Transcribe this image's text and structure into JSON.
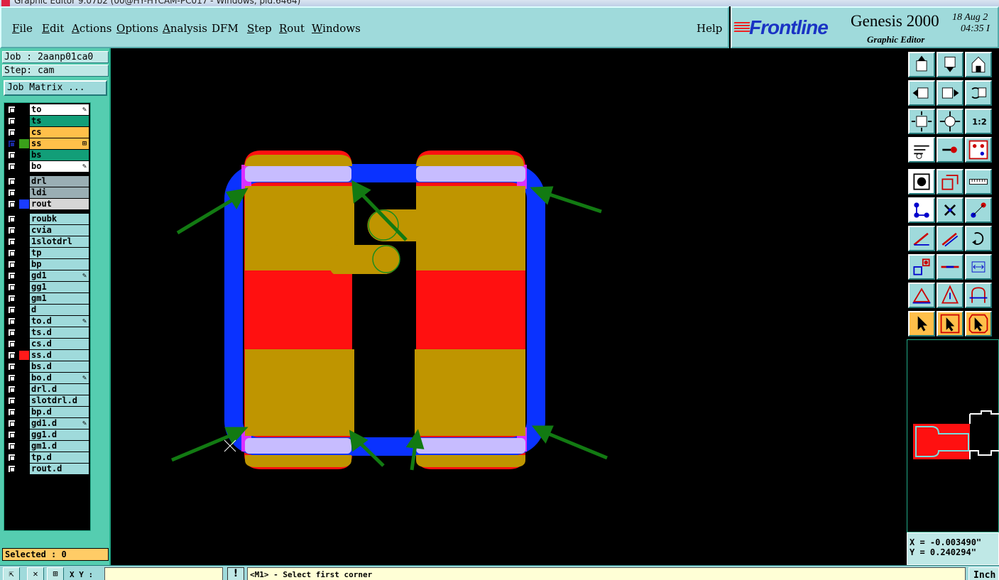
{
  "window": {
    "title": "Graphic Editor 9.07b2 (00@HY-HYCAM-PC017 - Windows, pid:6464)"
  },
  "menu": [
    {
      "label": "File",
      "ul": "F",
      "rest": "ile"
    },
    {
      "label": "Edit",
      "ul": "E",
      "rest": "dit"
    },
    {
      "label": "Actions",
      "ul": "A",
      "rest": "ctions"
    },
    {
      "label": "Options",
      "ul": "O",
      "rest": "ptions"
    },
    {
      "label": "Analysis",
      "ul": "A",
      "rest": "nalysis"
    },
    {
      "label": "DFM",
      "ul": "",
      "rest": "DFM"
    },
    {
      "label": "Step",
      "ul": "S",
      "rest": "tep"
    },
    {
      "label": "Rout",
      "ul": "R",
      "rest": "out"
    },
    {
      "label": "Windows",
      "ul": "W",
      "rest": "indows"
    },
    {
      "label": "Help",
      "ul": "",
      "rest": "Help"
    }
  ],
  "brand": {
    "logo": "Frontline",
    "product": "Genesis 2000",
    "subtitle": "Graphic Editor",
    "date": "18 Aug 2",
    "time": "04:35 I"
  },
  "job": {
    "job_label": "Job : 2aanp01ca0",
    "step_label": "Step: cam",
    "matrix_button": "Job Matrix ..."
  },
  "layers": [
    {
      "name": "to",
      "bg": "#ffffff",
      "swatch": "#000000",
      "mark": "✎"
    },
    {
      "name": "ts",
      "bg": "#129e78",
      "swatch": "#000000",
      "mark": ""
    },
    {
      "name": "cs",
      "bg": "#ffc04a",
      "swatch": "#000000",
      "mark": ""
    },
    {
      "name": "ss",
      "bg": "#ffc04a",
      "swatch": "#3aa01a",
      "mark": "⊞",
      "active": true
    },
    {
      "name": "bs",
      "bg": "#129e78",
      "swatch": "#000000",
      "mark": ""
    },
    {
      "name": "bo",
      "bg": "#ffffff",
      "swatch": "#000000",
      "mark": "✎"
    },
    {
      "name": "drl",
      "bg": "#9aaeb4",
      "swatch": "#000000",
      "mark": "",
      "gap": true
    },
    {
      "name": "ldi",
      "bg": "#9aaeb4",
      "swatch": "#000000",
      "mark": ""
    },
    {
      "name": "rout",
      "bg": "#d6d6d6",
      "swatch": "#1a3cff",
      "mark": ""
    },
    {
      "name": "roubk",
      "bg": "#9fdadb",
      "swatch": "#000000",
      "mark": "",
      "gap": true
    },
    {
      "name": "cvia",
      "bg": "#9fdadb",
      "swatch": "#000000",
      "mark": ""
    },
    {
      "name": "1slotdrl",
      "bg": "#9fdadb",
      "swatch": "#000000",
      "mark": ""
    },
    {
      "name": "tp",
      "bg": "#9fdadb",
      "swatch": "#000000",
      "mark": ""
    },
    {
      "name": "bp",
      "bg": "#9fdadb",
      "swatch": "#000000",
      "mark": ""
    },
    {
      "name": "gd1",
      "bg": "#9fdadb",
      "swatch": "#000000",
      "mark": "✎"
    },
    {
      "name": "gg1",
      "bg": "#9fdadb",
      "swatch": "#000000",
      "mark": ""
    },
    {
      "name": "gm1",
      "bg": "#9fdadb",
      "swatch": "#000000",
      "mark": ""
    },
    {
      "name": "d",
      "bg": "#9fdadb",
      "swatch": "#000000",
      "mark": ""
    },
    {
      "name": "to.d",
      "bg": "#9fdadb",
      "swatch": "#000000",
      "mark": "✎"
    },
    {
      "name": "ts.d",
      "bg": "#9fdadb",
      "swatch": "#000000",
      "mark": ""
    },
    {
      "name": "cs.d",
      "bg": "#9fdadb",
      "swatch": "#000000",
      "mark": ""
    },
    {
      "name": "ss.d",
      "bg": "#9fdadb",
      "swatch": "#ff1a1a",
      "mark": ""
    },
    {
      "name": "bs.d",
      "bg": "#9fdadb",
      "swatch": "#000000",
      "mark": ""
    },
    {
      "name": "bo.d",
      "bg": "#9fdadb",
      "swatch": "#000000",
      "mark": "✎"
    },
    {
      "name": "drl.d",
      "bg": "#9fdadb",
      "swatch": "#000000",
      "mark": ""
    },
    {
      "name": "slotdrl.d",
      "bg": "#9fdadb",
      "swatch": "#000000",
      "mark": ""
    },
    {
      "name": "bp.d",
      "bg": "#9fdadb",
      "swatch": "#000000",
      "mark": ""
    },
    {
      "name": "gd1.d",
      "bg": "#9fdadb",
      "swatch": "#000000",
      "mark": "✎"
    },
    {
      "name": "gg1.d",
      "bg": "#9fdadb",
      "swatch": "#000000",
      "mark": ""
    },
    {
      "name": "gm1.d",
      "bg": "#9fdadb",
      "swatch": "#000000",
      "mark": ""
    },
    {
      "name": "tp.d",
      "bg": "#9fdadb",
      "swatch": "#000000",
      "mark": ""
    },
    {
      "name": "rout.d",
      "bg": "#9fdadb",
      "swatch": "#000000",
      "mark": ""
    }
  ],
  "selected_label": "Selected : 0",
  "coords": {
    "x": "X = -0.003490\"",
    "y": "Y = 0.240294\""
  },
  "bottom": {
    "xy_label": "X Y :",
    "xy_value": "",
    "prompt": "<M1> - Select first corner",
    "units": "Inch"
  },
  "toolbar_icons": [
    "move-to-top-icon",
    "move-to-bottom-icon",
    "home-icon",
    "pan-left-icon",
    "pan-right-icon",
    "undo-zoom-icon",
    "zoom-fit-icon",
    "zoom-center-icon",
    "zoom-1to2-icon",
    "measure-tools-icon",
    "snap-icon",
    "traffic-icon",
    "fill-screen-icon",
    "draw-rect-icon",
    "ruler-icon",
    "connect-nodes-icon",
    "cross-icon",
    "point-to-point-icon",
    "line-red-icon",
    "line-blue-icon",
    "rotate-icon",
    "box-select-icon",
    "horizontal-line-icon",
    "dimension-icon",
    "triangle-icon",
    "triangle-up-icon",
    "arch-icon",
    "pointer-icon",
    "pointer-box-icon",
    "pointer-circle-icon"
  ],
  "colors": {
    "pad": "#bf9500",
    "rout": "#0a32ff",
    "mask": "#ff1010",
    "silk": "#c7bcff",
    "arrow": "#127a12"
  }
}
